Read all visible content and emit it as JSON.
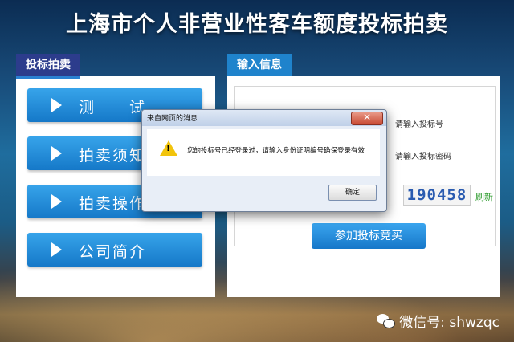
{
  "title": "上海市个人非营业性客车额度投标拍卖",
  "left_panel": {
    "tab_label": "投标拍卖",
    "menu": [
      {
        "label": "测　　试"
      },
      {
        "label": "拍卖须知"
      },
      {
        "label": "拍卖操作"
      },
      {
        "label": "公司简介"
      }
    ]
  },
  "right_panel": {
    "tab_label": "输入信息",
    "bid_number_hint": "请输入投标号",
    "bid_password_hint": "请输入投标密码",
    "captcha": "190458",
    "refresh_label": "刷新",
    "submit_label": "参加投标竞买"
  },
  "dialog": {
    "title": "来自网页的消息",
    "message": "您的投标号已经登录过，请输入身份证明编号确保登录有效",
    "ok_label": "确定",
    "close_glyph": "✕"
  },
  "watermark": {
    "text": "微信号: shwzqc"
  },
  "colors": {
    "accent_blue": "#1f83cc",
    "left_tab": "#2c3c8c",
    "warning": "#f2c40c"
  }
}
